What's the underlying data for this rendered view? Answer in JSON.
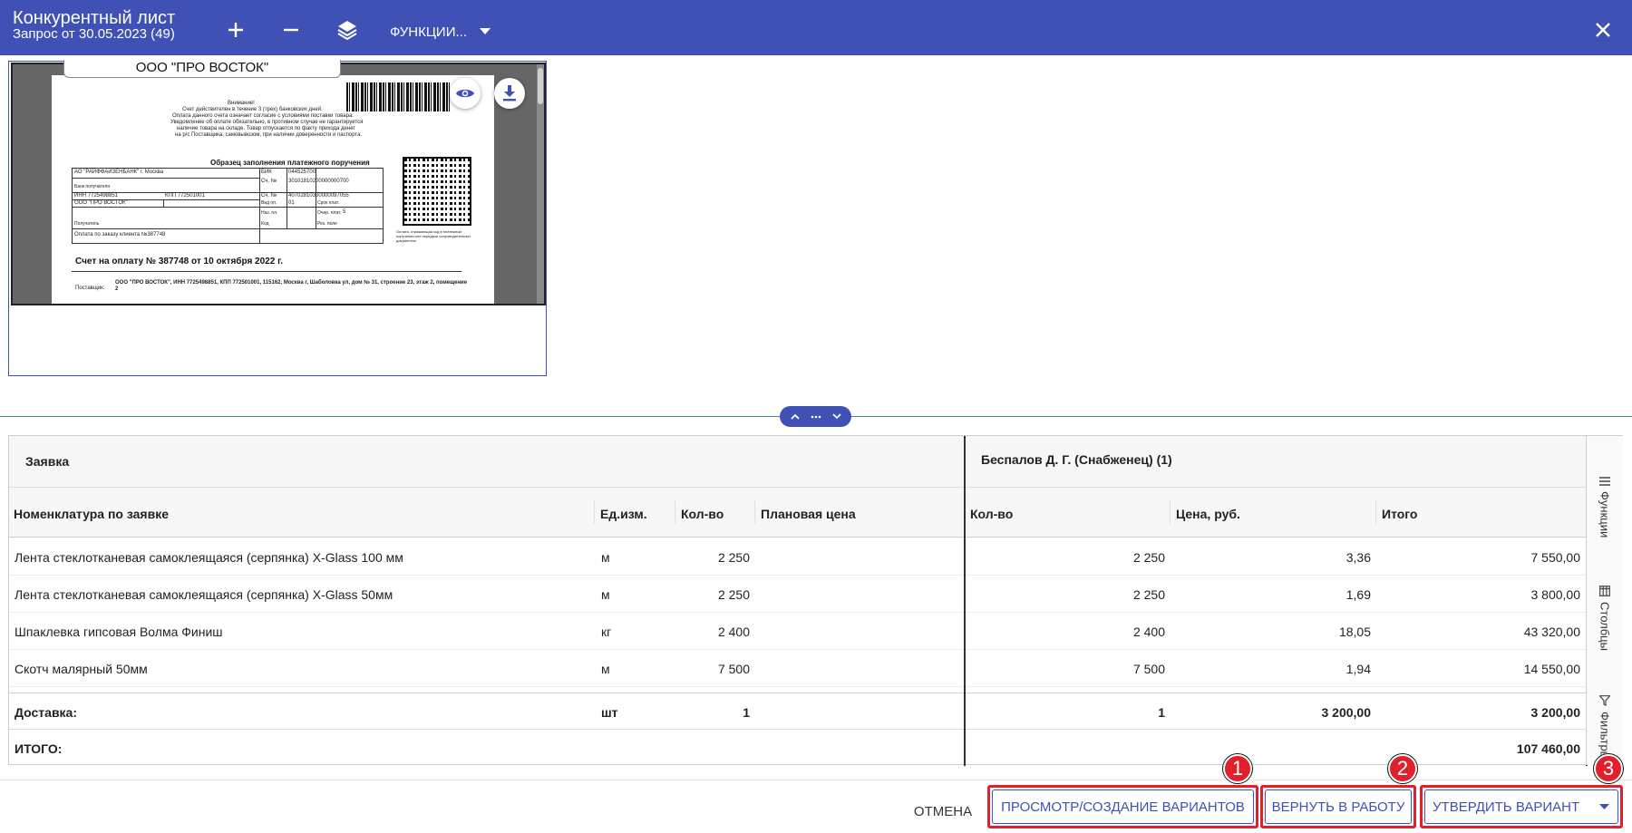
{
  "header": {
    "title": "Конкурентный лист",
    "subtitle": "Запрос от 30.05.2023 (49)",
    "functions_label": "ФУНКЦИИ...",
    "color": "#3f51b5"
  },
  "preview": {
    "supplier_tab": "ООО \"ПРО ВОСТОК\"",
    "doc": {
      "notice_title": "Внимание!",
      "notice_lines": [
        "Счет действителен в течение 3 (трех) банковских дней.",
        "Оплата данного счета означает согласие с условиями поставки товара.",
        "Уведомление об оплате обязательно, в противном случае не гарантируется",
        "наличие товара на складе. Товар отпускается по факту прихода денег",
        "на р/с Поставщика, самовывозом, при наличии доверенности и паспорта."
      ],
      "form_title": "Образец заполнения платежного поручения",
      "bank": "АО \"РАЙФФАЙЗЕНБАНК\" г. Москва",
      "bank_label": "Банк получателя",
      "bik_label": "БИК",
      "bik": "044525700",
      "sch_label": "Сч. №",
      "sch1": "30101810200000000700",
      "inn": "ИНН   7725498851",
      "kpp": "КПП   772501001",
      "sch2": "40702810300000097055",
      "recipient": "ООО \"ПРО ВОСТОК\"",
      "recipient_label": "Получатель",
      "vid_op": "Вид оп.",
      "vid_op_val": "01",
      "srok": "Срок плат.",
      "naz_pl": "Наз. пл.",
      "ocher": "Очер. плат.",
      "ocher_val": "5",
      "kod": "Код",
      "rez_pole": "Рез. поле",
      "payment_purpose": "Оплата по заказу клиента №387748",
      "stamp_note": "Оплата, отражающая код в платежном поручении или передачи сопроводительных документов",
      "invoice_title": "Счет на оплату № 387748 от 10 октября 2022 г.",
      "supplier_label": "Поставщик:",
      "supplier_text": "ООО \"ПРО ВОСТОК\", ИНН 7725498851, КПП 772501001, 115162, Москва г, Шаболовка ул, дом № 31, строение 23, этаж 2, помещение 2"
    }
  },
  "table": {
    "group_left": "Заявка",
    "group_right": "Беспалов Д. Г. (Снабженец) (1)",
    "columns": {
      "nomenclature": "Номенклатура по заявке",
      "unit": "Ед.изм.",
      "qty": "Кол-во",
      "plan_price": "Плановая цена",
      "qty2": "Кол-во",
      "price": "Цена, руб.",
      "total": "Итого"
    },
    "rows": [
      {
        "name": "Лента стеклотканевая самоклеящаяся (серпянка) X-Glass 100 мм",
        "unit": "м",
        "qty": "2 250",
        "plan_price": "",
        "qty2": "2 250",
        "price": "3,36",
        "total": "7 550,00"
      },
      {
        "name": "Лента стеклотканевая самоклеящаяся (серпянка) X-Glass 50мм",
        "unit": "м",
        "qty": "2 250",
        "plan_price": "",
        "qty2": "2 250",
        "price": "1,69",
        "total": "3 800,00"
      },
      {
        "name": "Шпаклевка гипсовая Волма Финиш",
        "unit": "кг",
        "qty": "2 400",
        "plan_price": "",
        "qty2": "2 400",
        "price": "18,05",
        "total": "43 320,00"
      },
      {
        "name": "Скотч малярный 50мм",
        "unit": "м",
        "qty": "7 500",
        "plan_price": "",
        "qty2": "7 500",
        "price": "1,94",
        "total": "14 550,00"
      }
    ],
    "delivery": {
      "name": "Доставка:",
      "unit": "шт",
      "qty": "1",
      "qty2": "1",
      "price": "3 200,00",
      "total": "3 200,00"
    },
    "grand_total": {
      "name": "ИТОГО:",
      "total": "107 460,00"
    }
  },
  "side_panel": {
    "functions": "Функции",
    "columns": "Столбцы",
    "filters": "Фильтры"
  },
  "actions": {
    "cancel": "ОТМЕНА",
    "view_create": "ПРОСМОТР/СОЗДАНИЕ ВАРИАНТОВ",
    "return": "ВЕРНУТЬ В РАБОТУ",
    "approve": "УТВЕРДИТЬ ВАРИАНТ",
    "badge1": "1",
    "badge2": "2",
    "badge3": "3",
    "highlight_color": "#e0202a"
  }
}
